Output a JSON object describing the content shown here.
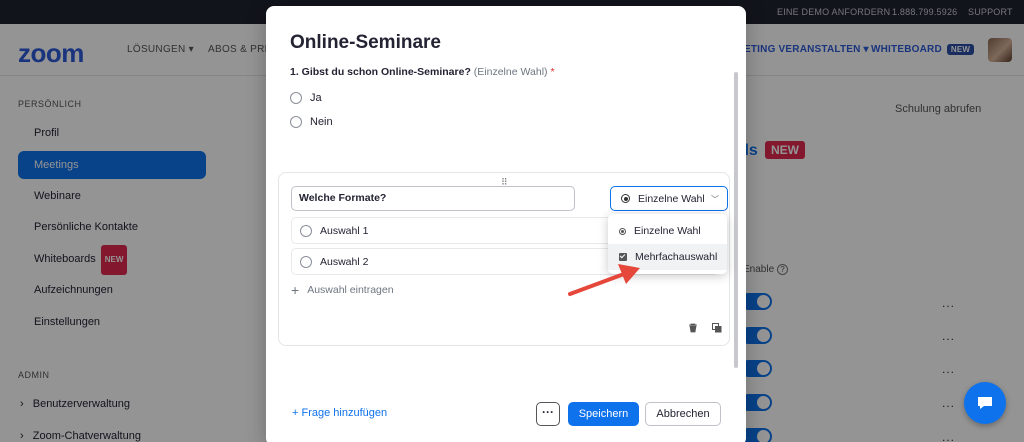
{
  "topbar": {
    "demo": "EINE DEMO ANFORDERN",
    "phone": "1.888.799.5926",
    "support": "SUPPORT"
  },
  "navbar": {
    "logo": "zoom",
    "items": [
      "LÖSUNGEN",
      "ABOS & PREIS"
    ],
    "right_items": [
      "ETING VERANSTALTEN",
      "WHITEBOARD"
    ],
    "new_badge": "NEW"
  },
  "sidebar": {
    "section_personal": "PERSÖNLICH",
    "items": [
      {
        "label": "Profil"
      },
      {
        "label": "Meetings"
      },
      {
        "label": "Webinare"
      },
      {
        "label": "Persönliche Kontakte"
      },
      {
        "label": "Whiteboards",
        "badge": "NEW"
      },
      {
        "label": "Aufzeichnungen"
      },
      {
        "label": "Einstellungen"
      }
    ],
    "section_admin": "ADMIN",
    "admin_items": [
      "Benutzerverwaltung",
      "Zoom-Chatverwaltung"
    ]
  },
  "background": {
    "training_link": "Schulung abrufen",
    "tab_fragment": "ils",
    "tab_badge": "NEW",
    "enable_label": "Enable",
    "row_menu": "..."
  },
  "modal": {
    "title": "Online-Seminare",
    "question1": {
      "text": "1. Gibst du schon Online-Seminare?",
      "hint": "(Einzelne Wahl)",
      "required_mark": "*",
      "options": [
        "Ja",
        "Nein"
      ]
    },
    "question2": {
      "value": "Welche Formate?",
      "type_selected": "Einzelne Wahl",
      "choices": [
        "Auswahl 1",
        "Auswahl 2"
      ],
      "add_choice": "Auswahl eintragen"
    },
    "type_dropdown": {
      "options": [
        "Einzelne Wahl",
        "Mehrfachauswahl"
      ],
      "highlighted": "Mehrfachauswahl"
    },
    "footer": {
      "add_question": "+ Frage hinzufügen",
      "more": "···",
      "save": "Speichern",
      "cancel": "Abbrechen"
    }
  },
  "colors": {
    "accent": "#0e72ed",
    "arrow": "#e5483b",
    "required": "#e02828"
  }
}
